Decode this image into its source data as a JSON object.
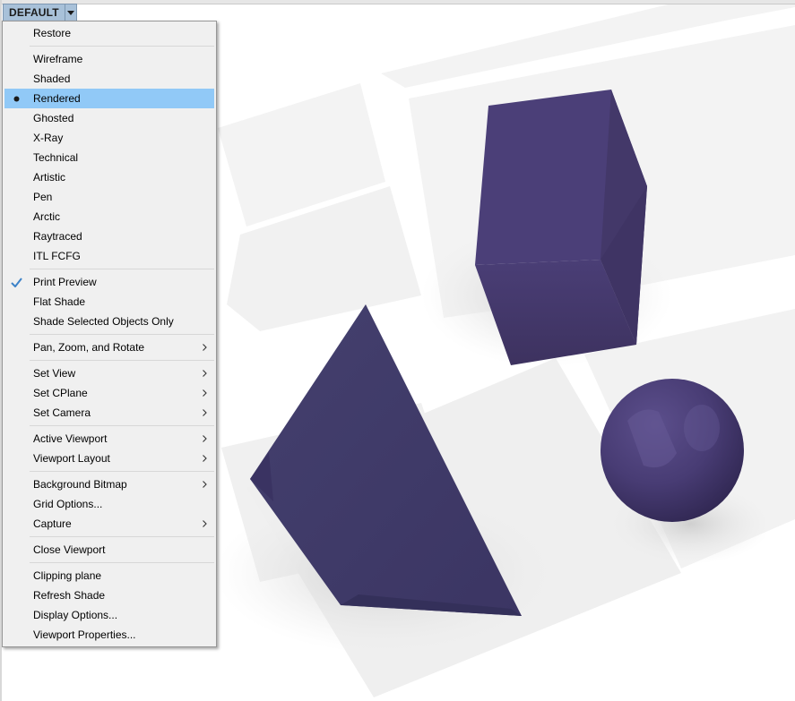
{
  "viewport": {
    "title": "DEFAULT",
    "object_color": "#463b6e"
  },
  "menu": {
    "groups": [
      [
        {
          "label": "Restore"
        }
      ],
      [
        {
          "label": "Wireframe"
        },
        {
          "label": "Shaded"
        },
        {
          "label": "Rendered",
          "state": "selected",
          "highlighted": true
        },
        {
          "label": "Ghosted"
        },
        {
          "label": "X-Ray"
        },
        {
          "label": "Technical"
        },
        {
          "label": "Artistic"
        },
        {
          "label": "Pen"
        },
        {
          "label": "Arctic"
        },
        {
          "label": "Raytraced"
        },
        {
          "label": "ITL FCFG"
        }
      ],
      [
        {
          "label": "Print Preview",
          "state": "checked"
        },
        {
          "label": "Flat Shade"
        },
        {
          "label": "Shade Selected Objects Only"
        }
      ],
      [
        {
          "label": "Pan, Zoom, and Rotate",
          "submenu": true
        }
      ],
      [
        {
          "label": "Set View",
          "submenu": true
        },
        {
          "label": "Set CPlane",
          "submenu": true
        },
        {
          "label": "Set Camera",
          "submenu": true
        }
      ],
      [
        {
          "label": "Active Viewport",
          "submenu": true
        },
        {
          "label": "Viewport Layout",
          "submenu": true
        }
      ],
      [
        {
          "label": "Background Bitmap",
          "submenu": true
        },
        {
          "label": "Grid Options..."
        },
        {
          "label": "Capture",
          "submenu": true
        }
      ],
      [
        {
          "label": "Close Viewport"
        }
      ],
      [
        {
          "label": "Clipping plane"
        },
        {
          "label": "Refresh Shade"
        },
        {
          "label": "Display Options..."
        },
        {
          "label": "Viewport Properties..."
        }
      ]
    ]
  },
  "colors": {
    "menu_highlight": "#91c9f7",
    "check_mark": "#3c82c8",
    "tab_background": "#a8c1d9"
  }
}
